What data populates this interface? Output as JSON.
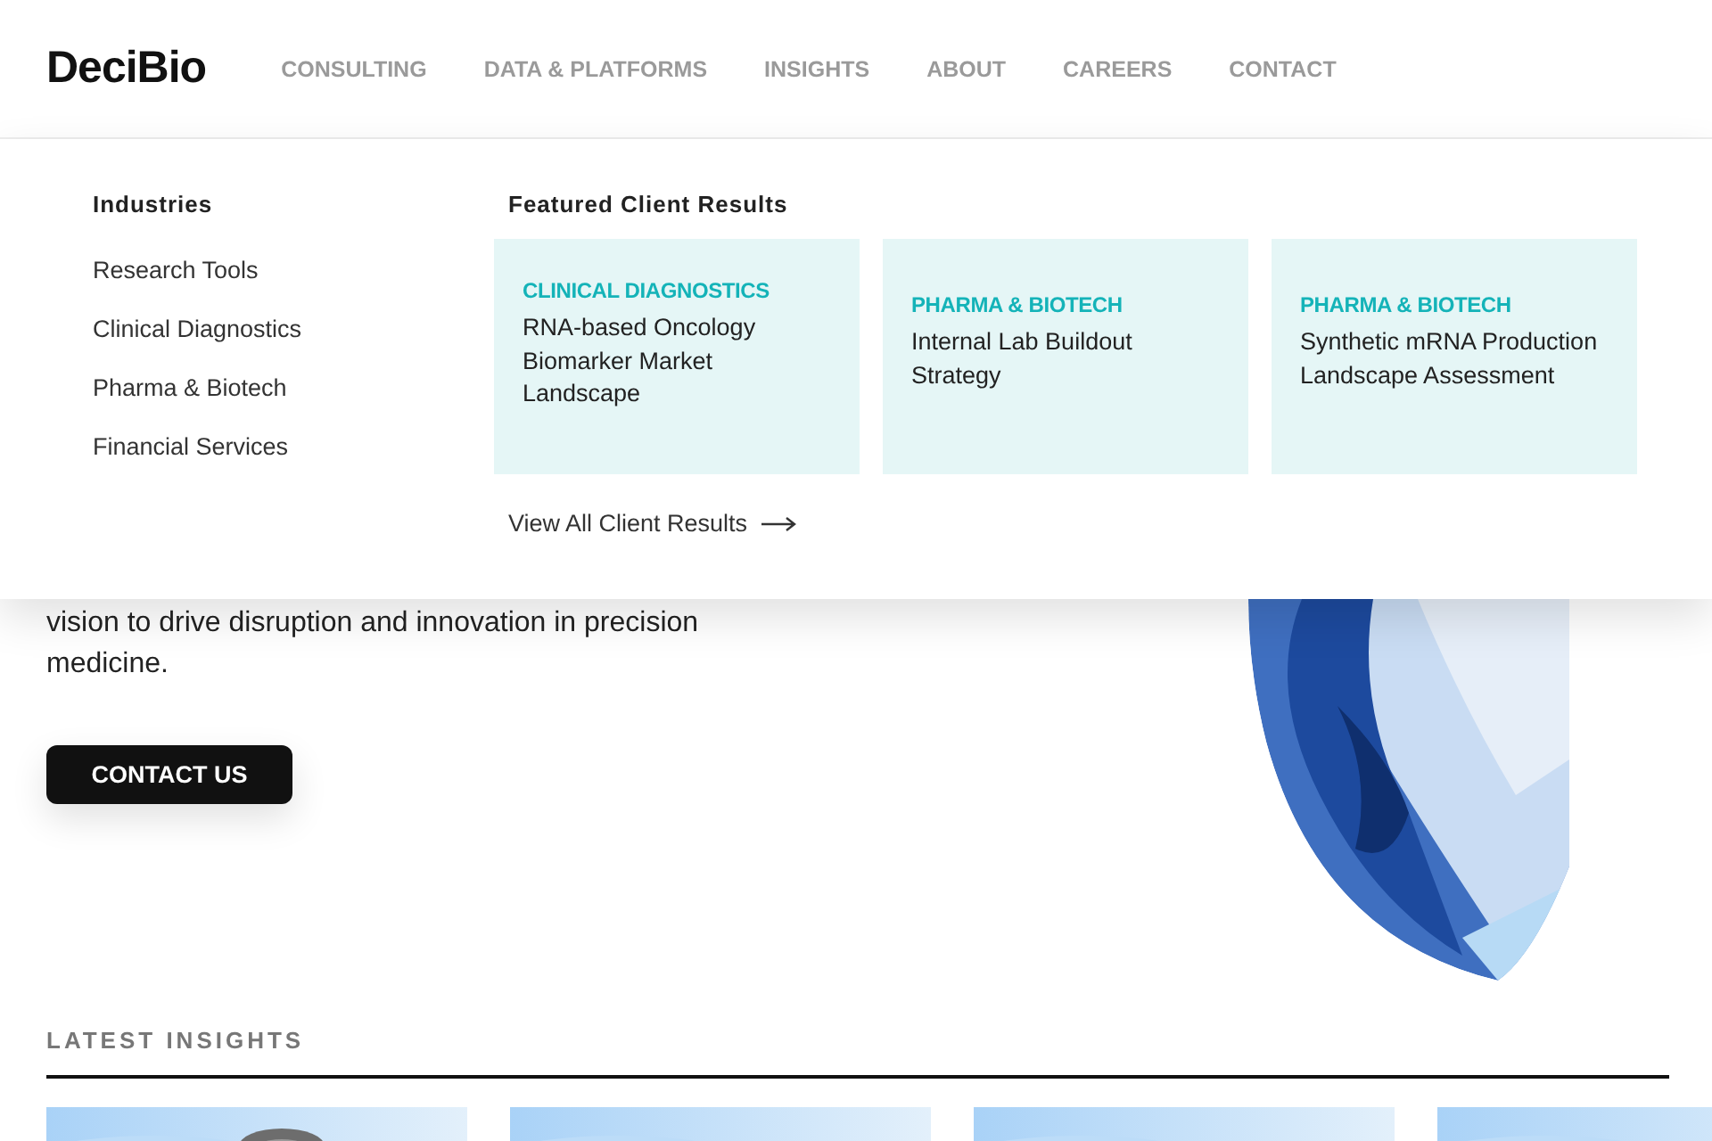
{
  "header": {
    "logo": "DeciBio",
    "nav": [
      "CONSULTING",
      "DATA & PLATFORMS",
      "INSIGHTS",
      "ABOUT",
      "CAREERS",
      "CONTACT"
    ]
  },
  "dropdown": {
    "industries": {
      "heading": "Industries",
      "items": [
        "Research Tools",
        "Clinical Diagnostics",
        "Pharma & Biotech",
        "Financial Services"
      ]
    },
    "featured": {
      "heading": "Featured Client Results",
      "cards": [
        {
          "category": "CLINICAL DIAGNOSTICS",
          "title": "RNA-based Oncology Biomarker Market Landscape"
        },
        {
          "category": "PHARMA & BIOTECH",
          "title": "Internal Lab Buildout Strategy"
        },
        {
          "category": "PHARMA & BIOTECH",
          "title": "Synthetic mRNA Production Landscape Assessment"
        }
      ],
      "link": "View All Client Results"
    }
  },
  "hero": {
    "text": "vision to drive disruption and innovation in precision medicine.",
    "button": "CONTACT US"
  },
  "insights": {
    "heading": "LATEST INSIGHTS"
  }
}
